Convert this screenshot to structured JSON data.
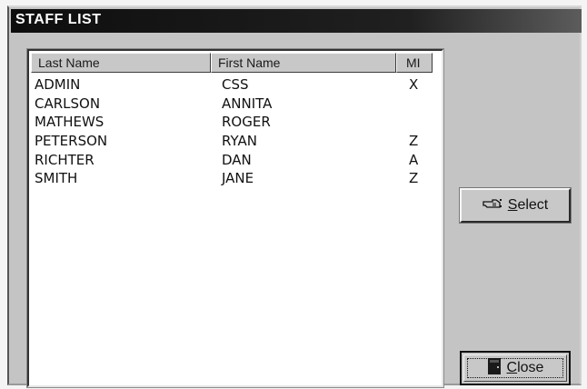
{
  "window": {
    "title": "STAFF LIST"
  },
  "list": {
    "columns": {
      "last_name": "Last Name",
      "first_name": "First Name",
      "mi": "MI"
    },
    "rows": [
      {
        "last": "ADMIN",
        "first": "CSS",
        "mi": "X"
      },
      {
        "last": "CARLSON",
        "first": "ANNITA",
        "mi": ""
      },
      {
        "last": "MATHEWS",
        "first": "ROGER",
        "mi": ""
      },
      {
        "last": "PETERSON",
        "first": "RYAN",
        "mi": "Z"
      },
      {
        "last": "RICHTER",
        "first": "DAN",
        "mi": "A"
      },
      {
        "last": "SMITH",
        "first": "JANE",
        "mi": "Z"
      }
    ]
  },
  "buttons": {
    "select_label": "Select",
    "select_icon": "pointing-hand-icon",
    "close_label": "Close",
    "close_icon": "door-icon"
  },
  "colors": {
    "title_bar": "#0e0e0e",
    "window_face": "#c4c4c4",
    "list_background": "#ffffff"
  }
}
